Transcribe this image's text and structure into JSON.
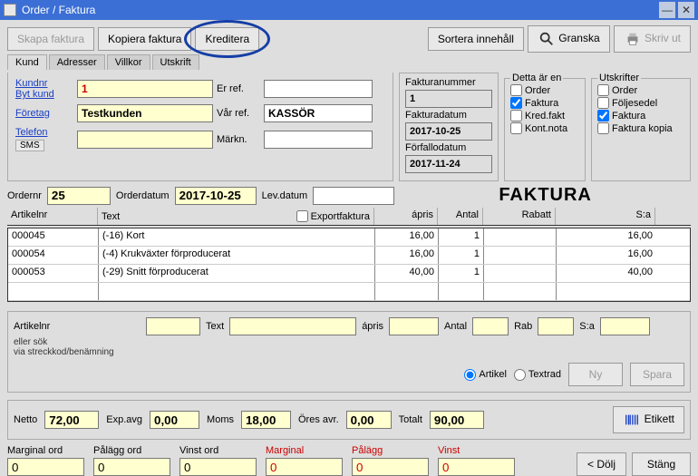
{
  "title": "Order / Faktura",
  "toolbar": {
    "skapa": "Skapa faktura",
    "kopiera": "Kopiera faktura",
    "kreditera": "Kreditera",
    "sortera": "Sortera innehåll",
    "granska": "Granska",
    "skriv": "Skriv ut"
  },
  "tabs": {
    "kund": "Kund",
    "adresser": "Adresser",
    "villkor": "Villkor",
    "utskrift": "Utskrift"
  },
  "kund": {
    "kundnr_link": "Kundnr",
    "bytkund_link": "Byt kund",
    "kundnr": "1",
    "erref_label": "Er ref.",
    "erref": "",
    "foretag_link": "Företag",
    "foretag": "Testkunden",
    "varref_label": "Vår ref.",
    "varref": "KASSÖR",
    "telefon_link": "Telefon",
    "sms": "SMS",
    "telefon": "",
    "markn_label": "Märkn.",
    "markn": ""
  },
  "faktura_meta": {
    "fakturanr_label": "Fakturanummer",
    "fakturanr": "1",
    "fakturadatum_label": "Fakturadatum",
    "fakturadatum": "2017-10-25",
    "forfall_label": "Förfallodatum",
    "forfall": "2017-11-24"
  },
  "detta": {
    "legend": "Detta är en",
    "order": "Order",
    "faktura": "Faktura",
    "kredfakt": "Kred.fakt",
    "kontnota": "Kont.nota",
    "checked": "faktura"
  },
  "utskrifter": {
    "legend": "Utskrifter",
    "order": "Order",
    "foljesedel": "Följesedel",
    "faktura": "Faktura",
    "fakturakopia": "Faktura kopia"
  },
  "order": {
    "ordernr_label": "Ordernr",
    "ordernr": "25",
    "orderdatum_label": "Orderdatum",
    "orderdatum": "2017-10-25",
    "levdatum_label": "Lev.datum",
    "levdatum": "",
    "doctitle": "FAKTURA",
    "export_label": "Exportfaktura"
  },
  "grid": {
    "head": {
      "art": "Artikelnr",
      "text": "Text",
      "pris": "ápris",
      "ant": "Antal",
      "rab": "Rabatt",
      "sa": "S:a"
    },
    "rows": [
      {
        "art": "000045",
        "text": "(-16) Kort",
        "pris": "16,00",
        "ant": "1",
        "rab": "",
        "sa": "16,00"
      },
      {
        "art": "000054",
        "text": "(-4) Krukväxter förproducerat",
        "pris": "16,00",
        "ant": "1",
        "rab": "",
        "sa": "16,00"
      },
      {
        "art": "000053",
        "text": "(-29) Snitt förproducerat",
        "pris": "40,00",
        "ant": "1",
        "rab": "",
        "sa": "40,00"
      }
    ]
  },
  "entry": {
    "art_label": "Artikelnr",
    "sub1": "eller sök",
    "sub2": "via streckkod/benämning",
    "text_label": "Text",
    "pris_label": "ápris",
    "ant_label": "Antal",
    "rab_label": "Rab",
    "sa_label": "S:a",
    "artikel": "Artikel",
    "textrad": "Textrad",
    "ny": "Ny",
    "spara": "Spara"
  },
  "totals": {
    "netto_label": "Netto",
    "netto": "72,00",
    "expavg_label": "Exp.avg",
    "expavg": "0,00",
    "moms_label": "Moms",
    "moms": "18,00",
    "ores_label": "Öres avr.",
    "ores": "0,00",
    "totalt_label": "Totalt",
    "totalt": "90,00",
    "etikett": "Etikett"
  },
  "marg": {
    "marginal_ord": "Marginal ord",
    "palagg_ord": "Pålägg ord",
    "vinst_ord": "Vinst ord",
    "marginal": "Marginal",
    "palagg": "Pålägg",
    "vinst": "Vinst",
    "zero": "0",
    "dolj": "< Dölj",
    "stang": "Stäng"
  }
}
